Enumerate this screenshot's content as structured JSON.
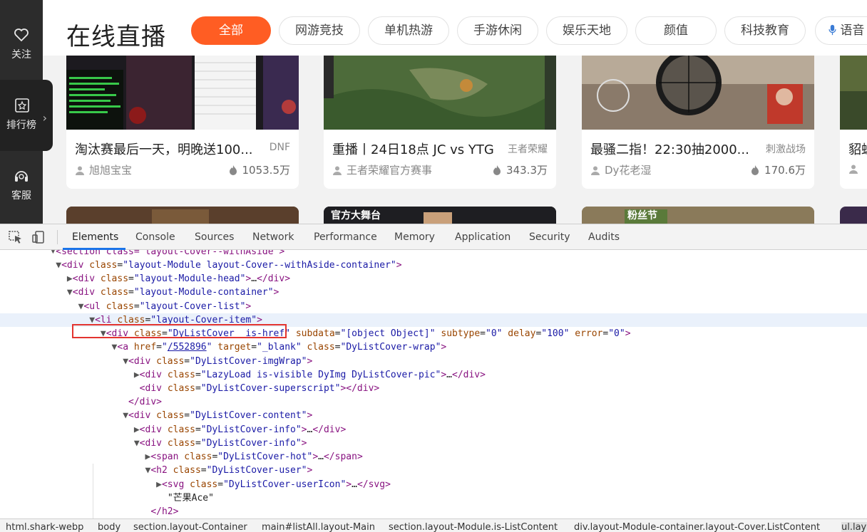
{
  "sidebar": {
    "items": [
      {
        "label": "关注",
        "icon": "heart-icon"
      },
      {
        "label": "排行榜",
        "icon": "ranking-icon"
      },
      {
        "label": "客服",
        "icon": "headset-icon"
      }
    ]
  },
  "header": {
    "title": "在线直播",
    "categories": [
      "全部",
      "网游竞技",
      "单机热游",
      "手游休闲",
      "娱乐天地",
      "颜值",
      "科技教育",
      "语音"
    ],
    "active_category": "全部"
  },
  "cards": [
    {
      "title": "淘汰赛最后一天，明晚送100...",
      "category": "DNF",
      "user": "旭旭宝宝",
      "hot": "1053.5万"
    },
    {
      "title": "重播丨24日18点 JC vs YTG",
      "category": "王者荣耀",
      "user": "王者荣耀官方赛事",
      "hot": "343.3万"
    },
    {
      "title": "最骚二指！22:30抽2000...",
      "category": "刺激战场",
      "user": "Dy花老湿",
      "hot": "170.6万"
    },
    {
      "title": "貂蝉",
      "category": "",
      "user": "",
      "hot": ""
    }
  ],
  "row2_badges": [
    "",
    "官方大舞台",
    "粉丝节",
    ""
  ],
  "devtools": {
    "tabs": [
      "Elements",
      "Console",
      "Sources",
      "Network",
      "Performance",
      "Memory",
      "Application",
      "Security",
      "Audits"
    ],
    "active_tab": "Elements",
    "dom": {
      "l0": "section class=\"layout-Cover--withAside\"",
      "l1_tag": "div",
      "l1_attr": "class",
      "l1_val": "layout-Module layout-Cover--withAside-container",
      "l2_val": "layout-Module-head",
      "l3_val": "layout-Module-container",
      "l4_val": "layout-Cover-list",
      "l5_val": "layout-Cover-item",
      "l6_class": "DyListCover  is-href",
      "l6_subdata": "[object Object]",
      "l6_subtype": "0",
      "l6_delay": "100",
      "l6_error": "0",
      "l7_href": "/552896",
      "l7_target": "_blank",
      "l7_class": "DyListCover-wrap",
      "l8_val": "DyListCover-imgWrap",
      "l9_val": "LazyLoad is-visible DyImg DyListCover-pic",
      "l10_val": "DyListCover-superscript",
      "l12_val": "DyListCover-content",
      "l13_val": "DyListCover-info",
      "l14_val": "DyListCover-info",
      "l15_val": "DyListCover-hot",
      "l16_val": "DyListCover-user",
      "l17_val": "DyListCover-userIcon",
      "l18_text": "\"芒果Ace\""
    },
    "breadcrumbs": [
      "html.shark-webp",
      "body",
      "section.layout-Container",
      "main#listAll.layout-Main",
      "section.layout-Module.is-ListContent",
      "div.layout-Module-container.layout-Cover.ListContent",
      "ul.layout-Cover-list"
    ]
  },
  "colors": {
    "accent": "#ff5d23",
    "sidebar": "#2c2c2c",
    "selection_box": "#e3342f",
    "devtools_tab_underline": "#1a73e8"
  }
}
